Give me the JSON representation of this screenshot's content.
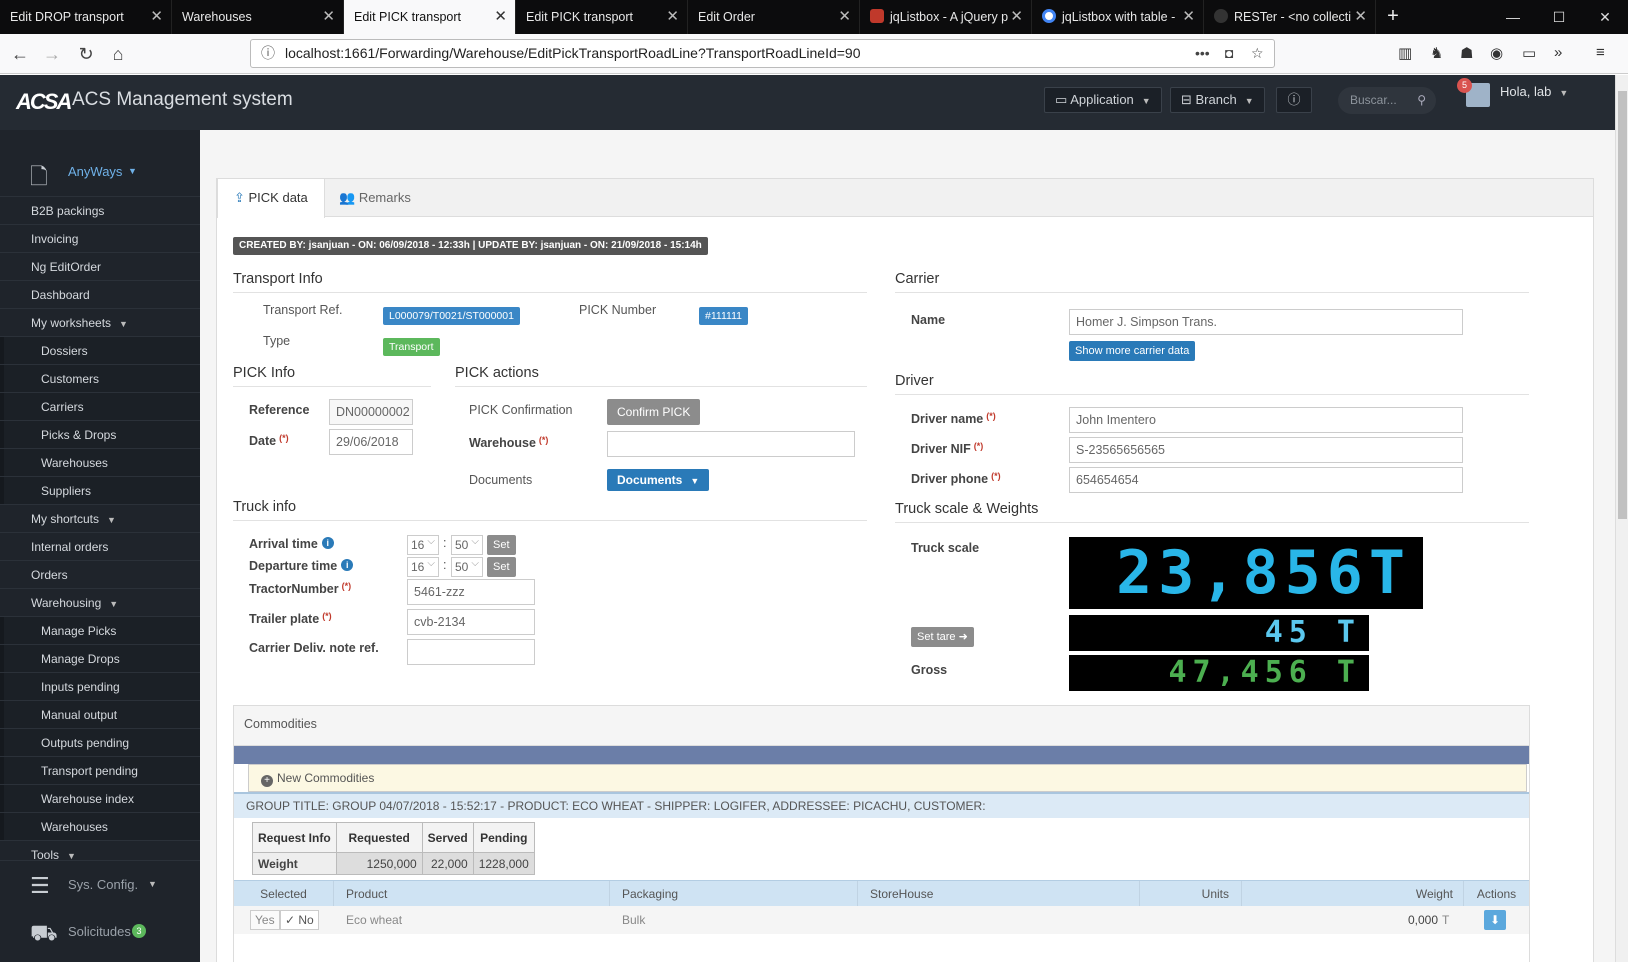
{
  "browser": {
    "tabs": [
      {
        "title": "Edit DROP transport",
        "active": false
      },
      {
        "title": "Warehouses",
        "active": false
      },
      {
        "title": "Edit PICK transport",
        "active": true
      },
      {
        "title": "Edit PICK transport",
        "active": false
      },
      {
        "title": "Edit Order",
        "active": false
      },
      {
        "title": "jqListbox - A jQuery p",
        "active": false
      },
      {
        "title": "jqListbox with table -",
        "active": false
      },
      {
        "title": "RESTer - <no collecti",
        "active": false
      }
    ],
    "close_glyph": "✕",
    "new_tab_glyph": "+",
    "url": "localhost:1661/Forwarding/Warehouse/EditPickTransportRoadLine?TransportRoadLineId=90"
  },
  "app": {
    "title": "ACS Management system",
    "logo_text": "ACSA",
    "application_label": "Application",
    "branch_label": "Branch",
    "search_placeholder": "Buscar...",
    "notifications_count": "5",
    "greeting": "Hola, lab"
  },
  "sidebar": {
    "company": "AnyWays",
    "items": [
      {
        "label": "B2B packings",
        "level": 1
      },
      {
        "label": "Invoicing",
        "level": 1
      },
      {
        "label": "Ng EditOrder",
        "level": 1
      },
      {
        "label": "Dashboard",
        "level": 1
      },
      {
        "label": "My worksheets",
        "level": 1,
        "caret": true
      },
      {
        "label": "Dossiers",
        "level": 2
      },
      {
        "label": "Customers",
        "level": 2
      },
      {
        "label": "Carriers",
        "level": 2
      },
      {
        "label": "Picks & Drops",
        "level": 2
      },
      {
        "label": "Warehouses",
        "level": 2
      },
      {
        "label": "Suppliers",
        "level": 2
      },
      {
        "label": "My shortcuts",
        "level": 1,
        "caret": true
      },
      {
        "label": "Internal orders",
        "level": 1
      },
      {
        "label": "Orders",
        "level": 1
      },
      {
        "label": "Warehousing",
        "level": 1,
        "caret": true
      },
      {
        "label": "Manage Picks",
        "level": 2
      },
      {
        "label": "Manage Drops",
        "level": 2
      },
      {
        "label": "Inputs pending",
        "level": 2
      },
      {
        "label": "Manual output",
        "level": 2
      },
      {
        "label": "Outputs pending",
        "level": 2
      },
      {
        "label": "Transport pending",
        "level": 2
      },
      {
        "label": "Warehouse index",
        "level": 2
      },
      {
        "label": "Warehouses",
        "level": 2
      },
      {
        "label": "Tools",
        "level": 1,
        "caret": true
      }
    ],
    "sys_config": "Sys. Config.",
    "solicitudes": "Solicitudes",
    "solicitudes_count": "3"
  },
  "tabs": {
    "pick_data": "PICK data",
    "remarks": "Remarks"
  },
  "created_by": "CREATED BY: jsanjuan - ON: 06/09/2018 - 12:33h | UPDATE BY: jsanjuan - ON: 21/09/2018 - 15:14h",
  "transport_info": {
    "title": "Transport Info",
    "ref_label": "Transport Ref.",
    "ref_value": "L000079/T0021/ST000001",
    "pick_number_label": "PICK Number",
    "pick_number_value": "#111111",
    "type_label": "Type",
    "type_value": "Transport"
  },
  "pick_info": {
    "title": "PICK Info",
    "reference_label": "Reference",
    "reference_value": "DN00000002",
    "date_label": "Date",
    "date_value": "29/06/2018"
  },
  "pick_actions": {
    "title": "PICK actions",
    "confirmation_label": "PICK Confirmation",
    "confirm_button": "Confirm PICK",
    "warehouse_label": "Warehouse",
    "warehouse_value": "",
    "documents_label": "Documents",
    "documents_button": "Documents"
  },
  "required_mark": "(*)",
  "truck_info": {
    "title": "Truck info",
    "arrival_label": "Arrival time",
    "arrival_hour": "16",
    "arrival_min": "50",
    "departure_label": "Departure time",
    "departure_hour": "16",
    "departure_min": "50",
    "set_label": "Set",
    "colon": ":",
    "tractor_label": "TractorNumber",
    "tractor_value": "5461-zzz",
    "trailer_label": "Trailer plate",
    "trailer_value": "cvb-2134",
    "deliv_label": "Carrier Deliv. note ref.",
    "deliv_value": ""
  },
  "carrier": {
    "title": "Carrier",
    "name_label": "Name",
    "name_value": "Homer J. Simpson Trans.",
    "more_button": "Show more carrier data"
  },
  "driver": {
    "title": "Driver",
    "name_label": "Driver name",
    "name_value": "John Imentero",
    "nif_label": "Driver NIF",
    "nif_value": "S-23565656565",
    "phone_label": "Driver phone",
    "phone_value": "654654654"
  },
  "scale": {
    "title": "Truck scale & Weights",
    "truck_scale_label": "Truck scale",
    "truck_scale_value": "23,856T",
    "set_tare_button": "Set tare",
    "tare_value": "45 T",
    "gross_label": "Gross",
    "gross_value": "47,456 T",
    "colors": {
      "scale": "#29b6e8",
      "tare": "#5bc8ee",
      "gross": "#4caf50"
    }
  },
  "commodities": {
    "title": "Commodities",
    "new_label": "New Commodities",
    "group_title": "GROUP TITLE: GROUP 04/07/2018 - 15:52:17 - PRODUCT: ECO WHEAT - SHIPPER: LOGIFER, ADDRESSEE: PICACHU, CUSTOMER:",
    "request_table": {
      "headers": [
        "Request Info",
        "Requested",
        "Served",
        "Pending"
      ],
      "row": [
        "Weight",
        "1250,000",
        "22,000",
        "1228,000"
      ]
    },
    "product_headers": [
      "Selected",
      "Product",
      "Packaging",
      "StoreHouse",
      "Units",
      "Weight",
      "Actions"
    ],
    "product_row": {
      "yes": "Yes",
      "no": "✓ No",
      "product": "Eco wheat",
      "packaging": "Bulk",
      "storehouse": "",
      "units": "",
      "weight": "0,000",
      "weight_unit": "T"
    }
  }
}
